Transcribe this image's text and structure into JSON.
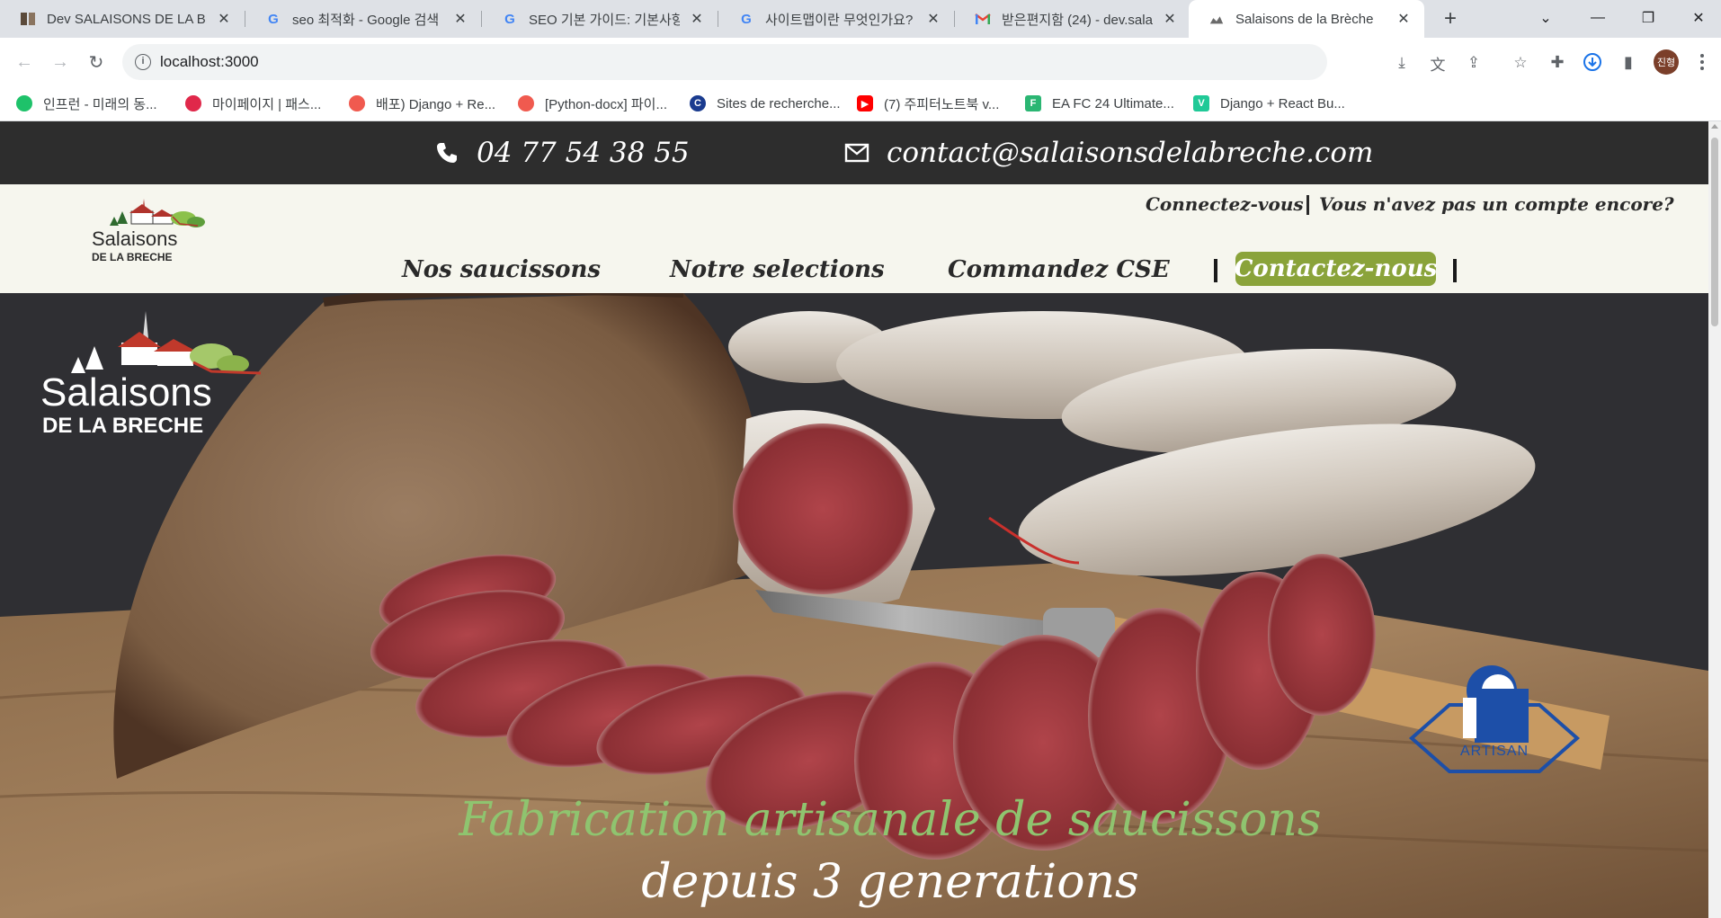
{
  "browser": {
    "tabs": [
      {
        "title": "Dev SALAISONS DE LA BR",
        "icon": "book-icon"
      },
      {
        "title": "seo 최적화 - Google 검색",
        "icon": "google-icon"
      },
      {
        "title": "SEO 기본 가이드: 기본사항",
        "icon": "google-icon"
      },
      {
        "title": "사이트맵이란 무엇인가요?",
        "icon": "google-icon"
      },
      {
        "title": "받은편지함 (24) - dev.sala",
        "icon": "gmail-icon"
      },
      {
        "title": "Salaisons de la Brèche",
        "icon": "site-favicon",
        "active": true
      }
    ],
    "new_tab_symbol": "+",
    "url": "localhost:3000",
    "profile_initials": "진형",
    "bookmarks": [
      {
        "label": "인프런 - 미래의 동...",
        "color": "#1ec26a",
        "icon": "inflearn-icon"
      },
      {
        "label": "마이페이지 | 패스...",
        "color": "#e0284a",
        "icon": "fastcampus-icon"
      },
      {
        "label": "배포) Django + Re...",
        "color": "#f05a4f",
        "icon": "velog-icon"
      },
      {
        "label": "[Python-docx] 파이...",
        "color": "#f05a4f",
        "icon": "velog-icon"
      },
      {
        "label": "Sites de recherche...",
        "color": "#1a3b8f",
        "icon": "circle-c-icon"
      },
      {
        "label": "(7) 주피터노트북 v...",
        "color": "#ff0000",
        "icon": "youtube-icon"
      },
      {
        "label": "EA FC 24 Ultimate...",
        "color": "#2bb673",
        "icon": "futbin-icon"
      },
      {
        "label": "Django + React Bu...",
        "color": "#20c997",
        "icon": "velog-v-icon"
      }
    ]
  },
  "site": {
    "topbar": {
      "phone": "04 77 54 38 55",
      "email": "contact@salaisonsdelabreche.com"
    },
    "logo_text_top": "Salaisons",
    "logo_text_bottom": "DE LA BRECHE",
    "account": {
      "login": "Connectez-vous",
      "signup": "Vous n'avez pas un compte encore?"
    },
    "menu": {
      "items": [
        "Nos saucissons",
        "Notre selections",
        "Commandez CSE"
      ],
      "contact": "Contactez-nous"
    },
    "hero": {
      "line1": "Fabrication artisanale de saucissons",
      "line2": "depuis 3 generations",
      "badge_text": "ARTISAN"
    },
    "colors": {
      "topbar": "#2d2d2d",
      "header": "#f6f6ee",
      "accent_green": "#8aa33a",
      "tagline_green": "#8fc46f",
      "artisan_blue": "#1d4fa8"
    }
  }
}
